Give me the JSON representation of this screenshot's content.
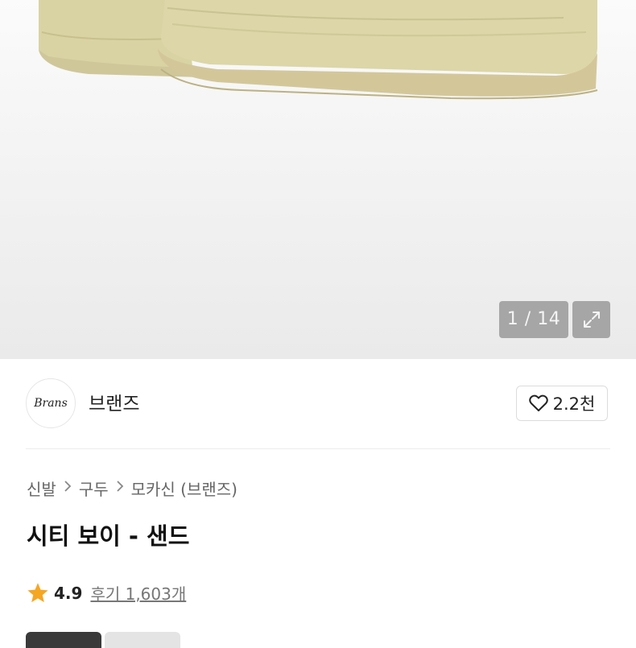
{
  "gallery": {
    "counter": "1 / 14",
    "expand_icon": "expand-icon"
  },
  "brand": {
    "logo_text": "Brans",
    "name": "브랜즈",
    "like_icon": "heart-outline-icon",
    "like_count": "2.2천"
  },
  "breadcrumb": {
    "items": [
      "신발",
      "구두",
      "모카신 (브랜즈)"
    ],
    "separator_icon": "chevron-right-icon"
  },
  "product": {
    "title": "시티 보이 - 샌드"
  },
  "rating": {
    "star_icon": "star-icon",
    "star_color": "#f5a623",
    "score": "4.9",
    "reviews": "후기 1,603개"
  }
}
